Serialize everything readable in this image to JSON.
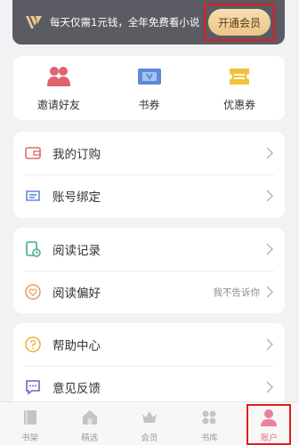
{
  "vip": {
    "slogan": "每天仅需1元钱，全年免费看小说",
    "button": "开通会员"
  },
  "shortcuts": [
    {
      "label": "邀请好友",
      "icon": "invite-friends-icon"
    },
    {
      "label": "书券",
      "icon": "book-coupon-icon"
    },
    {
      "label": "优惠券",
      "icon": "discount-coupon-icon"
    }
  ],
  "menu": {
    "orders": "我的订购",
    "bind": "账号绑定",
    "history": "阅读记录",
    "preference": "阅读偏好",
    "preference_hint": "我不告诉你",
    "help": "帮助中心",
    "feedback": "意见反馈"
  },
  "tabs": [
    {
      "label": "书架",
      "icon": "bookshelf-icon"
    },
    {
      "label": "精选",
      "icon": "home-icon"
    },
    {
      "label": "会员",
      "icon": "crown-icon"
    },
    {
      "label": "书库",
      "icon": "library-icon"
    },
    {
      "label": "账户",
      "icon": "account-icon"
    }
  ],
  "colors": {
    "accent": "#e76b8a",
    "highlight_border": "#e21c1c",
    "vip_bg": "#5b5b63"
  }
}
